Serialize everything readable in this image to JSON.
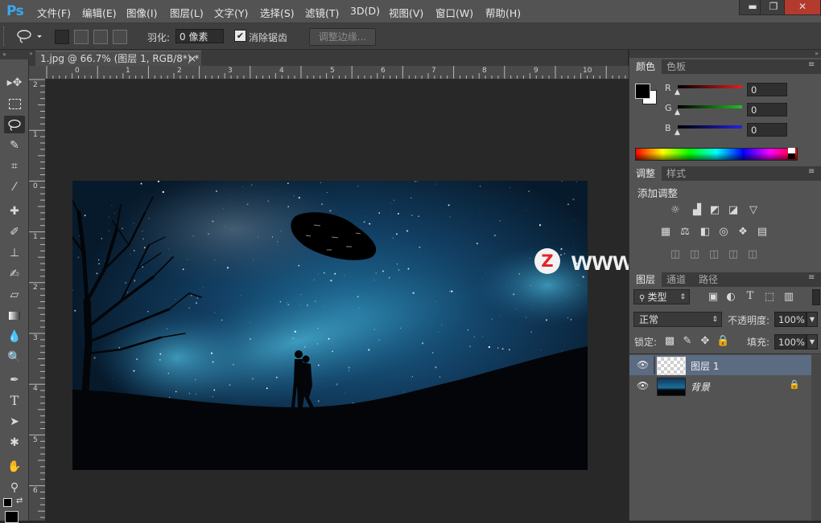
{
  "app": {
    "logo": "Ps"
  },
  "menus": [
    "文件(F)",
    "编辑(E)",
    "图像(I)",
    "图层(L)",
    "文字(Y)",
    "选择(S)",
    "滤镜(T)",
    "3D(D)",
    "视图(V)",
    "窗口(W)",
    "帮助(H)"
  ],
  "window_controls": {
    "minimize": "▬",
    "restore": "❐",
    "close": "✕"
  },
  "options": {
    "feather_label": "羽化:",
    "feather_value": "0 像素",
    "antialias_label": "消除锯齿",
    "antialias_checked": true,
    "refine_button": "调整边缘..."
  },
  "document": {
    "tab_title": "1.jpg @ 66.7% (图层 1, RGB/8*) *",
    "tab_close": "×"
  },
  "rulers": {
    "h_labels": [
      "0",
      "1",
      "2",
      "3",
      "4",
      "5",
      "6",
      "7",
      "8",
      "9",
      "10"
    ],
    "v_labels": [
      "2",
      "1",
      "0",
      "1",
      "2",
      "3",
      "4",
      "5",
      "6"
    ]
  },
  "color_panel": {
    "tabs": [
      "颜色",
      "色板"
    ],
    "active_tab": "颜色",
    "channels": [
      {
        "label": "R",
        "value": "0",
        "color": "#e01e1e"
      },
      {
        "label": "G",
        "value": "0",
        "color": "#22c022"
      },
      {
        "label": "B",
        "value": "0",
        "color": "#2222e0"
      }
    ],
    "foreground": "#000000",
    "background": "#ffffff"
  },
  "adjust_panel": {
    "tabs": [
      "调整",
      "样式"
    ],
    "active_tab": "调整",
    "title": "添加调整",
    "row1_icons": [
      "brightness-contrast-icon",
      "levels-icon",
      "curves-icon",
      "exposure-icon",
      "vibrance-icon"
    ],
    "row2_icons": [
      "hue-saturation-icon",
      "color-balance-icon",
      "black-white-icon",
      "photo-filter-icon",
      "channel-mixer-icon",
      "color-lookup-icon"
    ]
  },
  "layers_panel": {
    "tabs": [
      "图层",
      "通道",
      "路径"
    ],
    "active_tab": "图层",
    "filter_kind": "类型",
    "blend_mode": "正常",
    "opacity_label": "不透明度:",
    "opacity_value": "100%",
    "lock_label": "锁定:",
    "fill_label": "填充:",
    "fill_value": "100%",
    "layers": [
      {
        "name": "图层 1",
        "visible": true,
        "selected": true,
        "locked": false
      },
      {
        "name": "背景",
        "visible": true,
        "selected": false,
        "locked": true
      }
    ]
  },
  "watermark": {
    "badge": "Z",
    "text": "www.MacZ.com"
  },
  "colors": {
    "accent": "#3aa8ef",
    "panel": "#535353",
    "selected_layer": "#5b6b82"
  }
}
